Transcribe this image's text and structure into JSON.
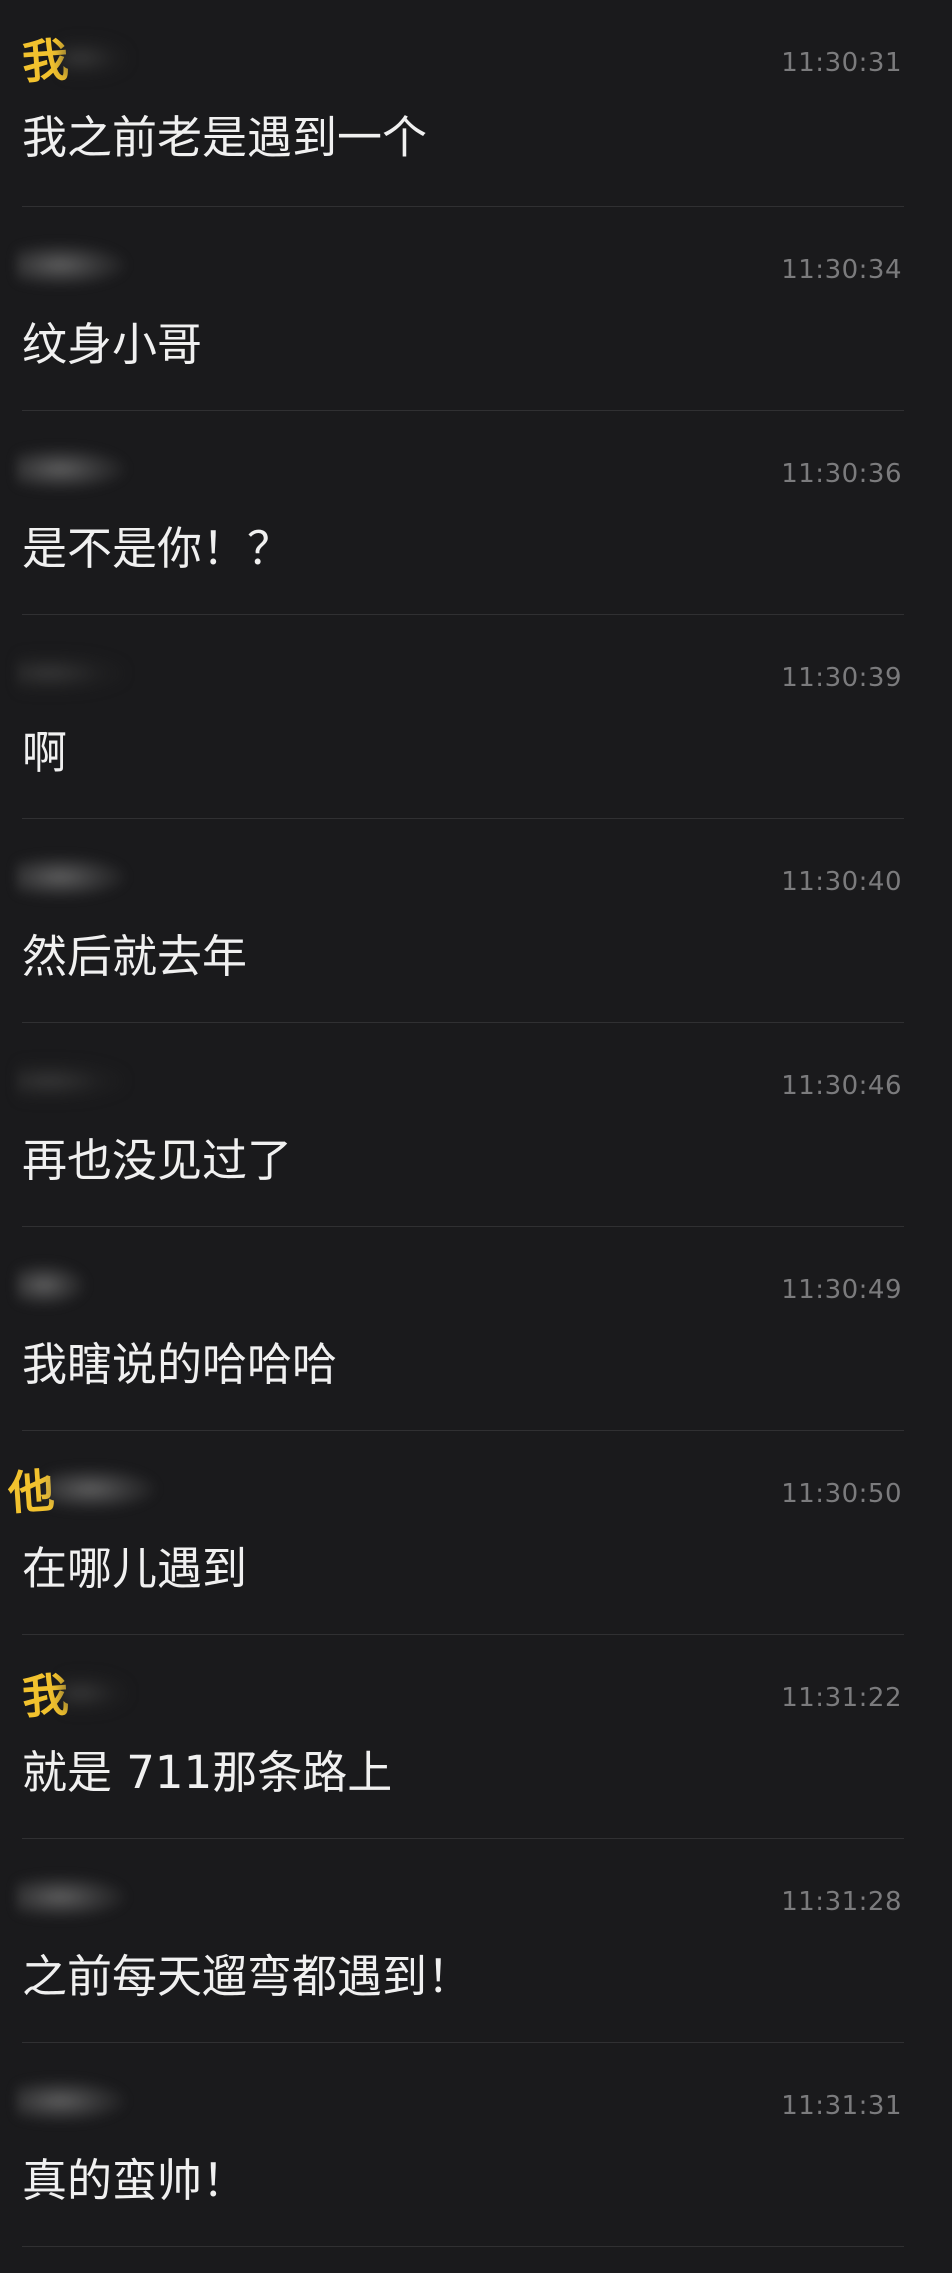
{
  "messages": [
    {
      "sender": "我",
      "time": "11:30:31",
      "text": "我之前老是遇到一个"
    },
    {
      "sender": "",
      "time": "11:30:34",
      "text": "纹身小哥"
    },
    {
      "sender": "",
      "time": "11:30:36",
      "text": "是不是你！？"
    },
    {
      "sender": "",
      "time": "11:30:39",
      "text": "啊"
    },
    {
      "sender": "",
      "time": "11:30:40",
      "text": "然后就去年"
    },
    {
      "sender": "",
      "time": "11:30:46",
      "text": "再也没见过了"
    },
    {
      "sender": "",
      "time": "11:30:49",
      "text": "我瞎说的哈哈哈"
    },
    {
      "sender": "他",
      "time": "11:30:50",
      "text": "在哪儿遇到"
    },
    {
      "sender": "我",
      "time": "11:31:22",
      "text": "就是 711那条路上"
    },
    {
      "sender": "",
      "time": "11:31:28",
      "text": "之前每天遛弯都遇到！"
    },
    {
      "sender": "",
      "time": "11:31:31",
      "text": "真的蛮帅！"
    }
  ],
  "colors": {
    "background": "#1a1a1c",
    "message_text": "#f0f0f0",
    "timestamp": "#7b7b7d",
    "sender_annotation": "#f2c22e",
    "divider": "#303032"
  }
}
